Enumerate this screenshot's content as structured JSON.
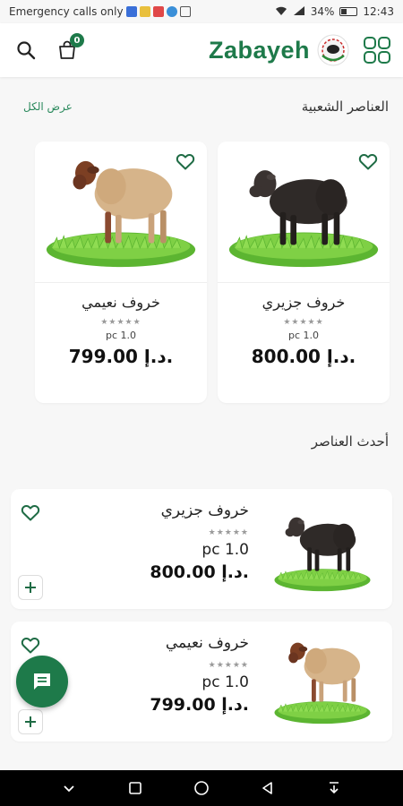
{
  "status": {
    "carrier_text": "Emergency calls only",
    "battery": "34%",
    "time": "12:43"
  },
  "header": {
    "brand": "Zabayeh",
    "cart_count": "0",
    "accent": "#1e7a4a"
  },
  "popular": {
    "title": "العناصر الشعبية",
    "see_all": "عرض الكل",
    "items": [
      {
        "name": "خروف جزيري",
        "stars": "★★★★★",
        "unit": "pc 1.0",
        "price": "800.00 د.إ."
      },
      {
        "name": "خروف نعيمي",
        "stars": "★★★★★",
        "unit": "pc 1.0",
        "price": "799.00 د.إ."
      }
    ]
  },
  "newest": {
    "title": "أحدث العناصر",
    "items": [
      {
        "name": "خروف جزيري",
        "stars": "★★★★★",
        "unit": "pc 1.0",
        "price": "800.00 د.إ."
      },
      {
        "name": "خروف نعيمي",
        "stars": "★★★★★",
        "unit": "pc 1.0",
        "price": "799.00 د.إ."
      }
    ]
  },
  "icons": {
    "search": "search-icon",
    "cart": "cart-icon",
    "grid": "grid-menu-icon",
    "heart": "heart-outline-icon",
    "plus": "plus-icon",
    "chat": "chat-icon"
  }
}
